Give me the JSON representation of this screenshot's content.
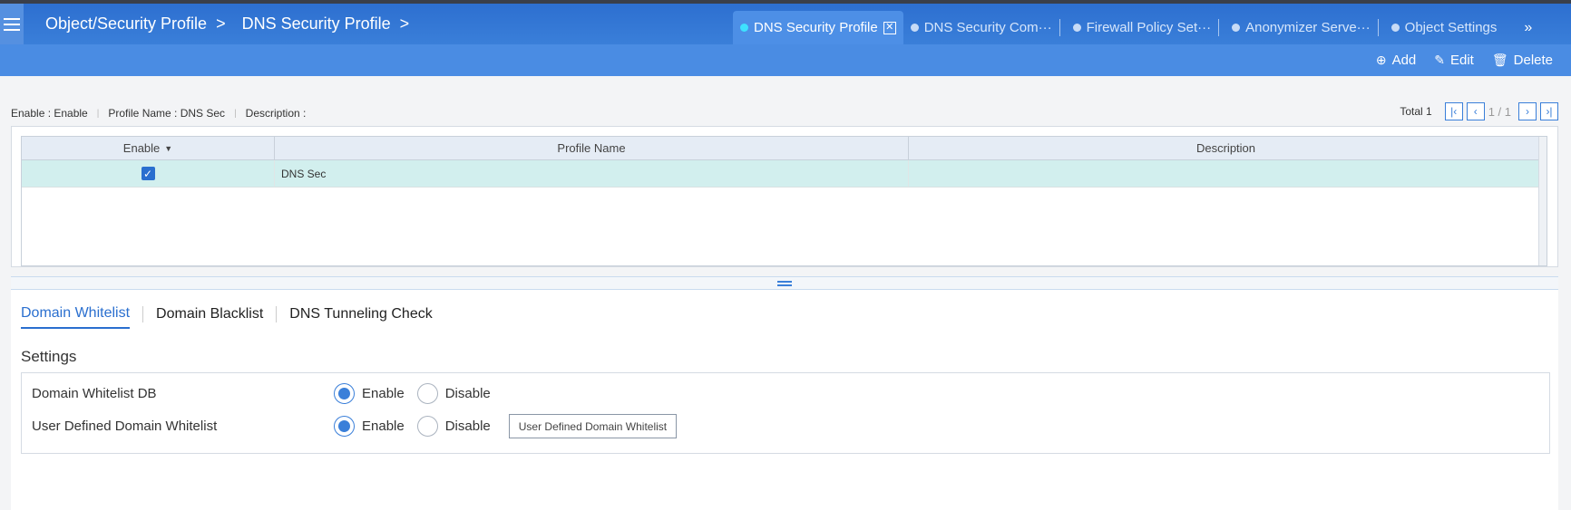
{
  "header": {
    "breadcrumb": [
      "Object/Security Profile",
      "DNS Security Profile"
    ],
    "breadcrumb_separator": ">",
    "tabs": [
      {
        "label": "DNS Security Profile",
        "active": true
      },
      {
        "label": "DNS Security Com···",
        "active": false
      },
      {
        "label": "Firewall Policy Set···",
        "active": false
      },
      {
        "label": "Anonymizer Serve···",
        "active": false
      },
      {
        "label": "Object Settings",
        "active": false
      }
    ],
    "more_label": "»"
  },
  "toolbar": {
    "add_label": "Add",
    "edit_label": "Edit",
    "delete_label": "Delete"
  },
  "filter": {
    "enable": "Enable : Enable",
    "profile_name": "Profile Name : DNS Sec",
    "description": "Description :"
  },
  "pager": {
    "total": "Total 1",
    "page": "1 / 1"
  },
  "grid": {
    "columns": [
      "Enable",
      "Profile Name",
      "Description"
    ],
    "rows": [
      {
        "enabled": true,
        "profile_name": "DNS Sec",
        "description": ""
      }
    ]
  },
  "subtabs": [
    "Domain Whitelist",
    "Domain Blacklist",
    "DNS Tunneling Check"
  ],
  "settings": {
    "title": "Settings",
    "rows": [
      {
        "label": "Domain Whitelist DB",
        "enable": "Enable",
        "disable": "Disable",
        "selected": "Enable"
      },
      {
        "label": "User Defined Domain Whitelist",
        "enable": "Enable",
        "disable": "Disable",
        "selected": "Enable",
        "button": "User Defined Domain Whitelist"
      }
    ]
  },
  "colors": {
    "header_blue": "#2d6fd0",
    "toolbar_blue": "#4a8ce3",
    "accent": "#2a6fcf",
    "row_highlight": "#d2efee",
    "active_dot": "#3ee2ff"
  }
}
